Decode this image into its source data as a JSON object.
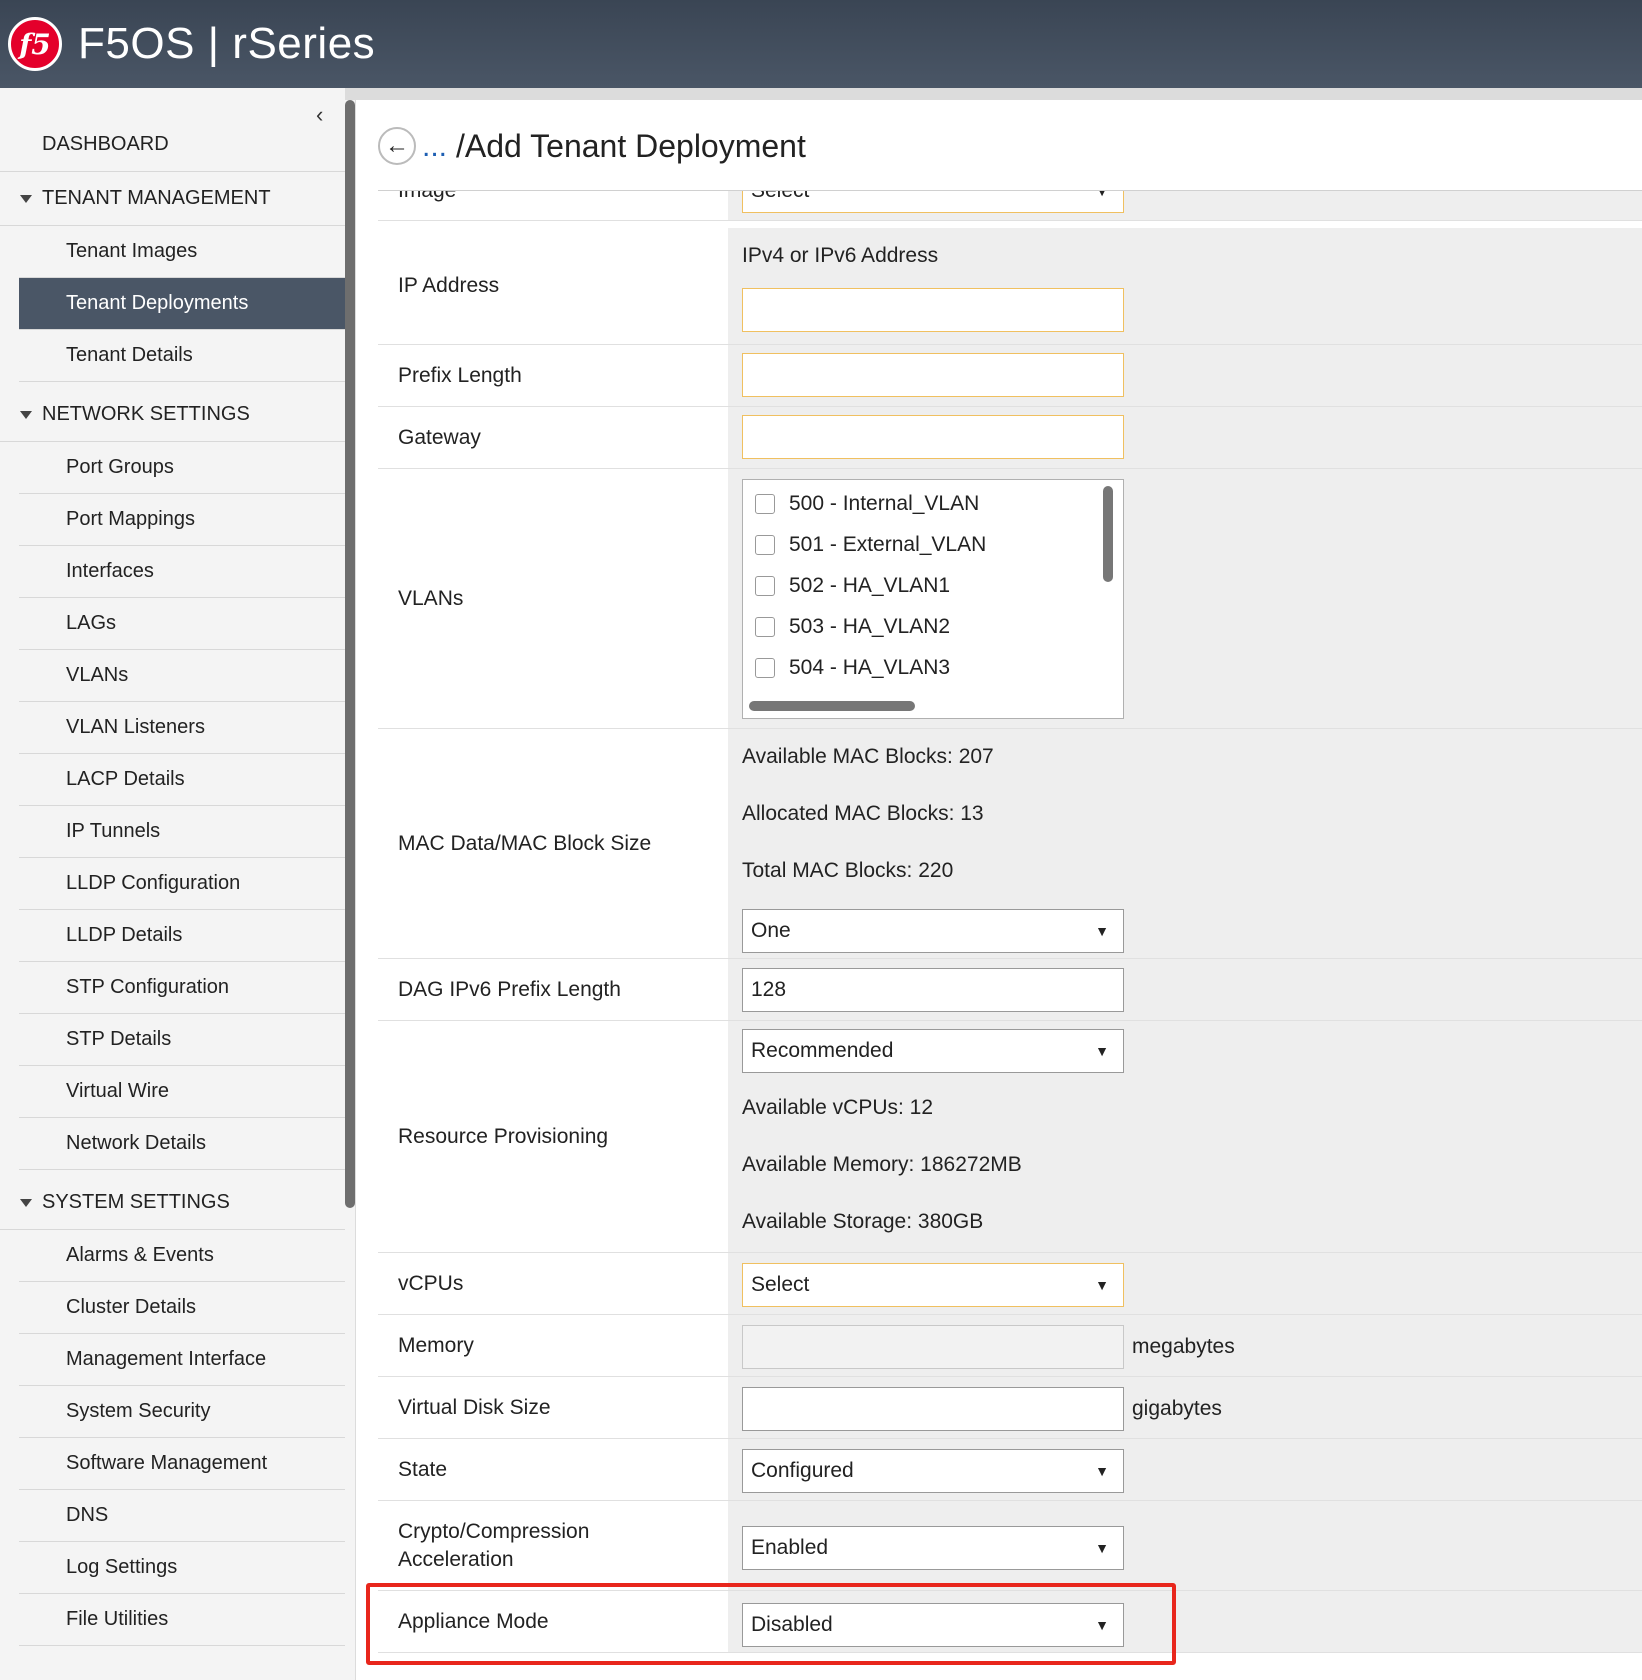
{
  "header": {
    "logo_text": "f5",
    "product": "F5OS | rSeries"
  },
  "sidebar": {
    "collapse_icon": "chevron-left-icon",
    "dashboard": "DASHBOARD",
    "tenant_management": {
      "title": "TENANT MANAGEMENT",
      "items": [
        "Tenant Images",
        "Tenant Deployments",
        "Tenant Details"
      ],
      "active": "Tenant Deployments"
    },
    "network_settings": {
      "title": "NETWORK SETTINGS",
      "items": [
        "Port Groups",
        "Port Mappings",
        "Interfaces",
        "LAGs",
        "VLANs",
        "VLAN Listeners",
        "LACP Details",
        "IP Tunnels",
        "LLDP Configuration",
        "LLDP Details",
        "STP Configuration",
        "STP Details",
        "Virtual Wire",
        "Network Details"
      ]
    },
    "system_settings": {
      "title": "SYSTEM SETTINGS",
      "items": [
        "Alarms & Events",
        "Cluster Details",
        "Management Interface",
        "System Security",
        "Software Management",
        "DNS",
        "Log Settings",
        "File Utilities"
      ]
    }
  },
  "page": {
    "breadcrumb_ellipsis": "...",
    "title": "/Add Tenant Deployment"
  },
  "form": {
    "image": {
      "label": "Image",
      "value": "Select"
    },
    "ip_address": {
      "label": "IP Address",
      "hint": "IPv4 or IPv6 Address",
      "value": ""
    },
    "prefix_length": {
      "label": "Prefix Length",
      "value": ""
    },
    "gateway": {
      "label": "Gateway",
      "value": ""
    },
    "vlans": {
      "label": "VLANs",
      "options": [
        "500 - Internal_VLAN",
        "501 - External_VLAN",
        "502 - HA_VLAN1",
        "503 - HA_VLAN2",
        "504 - HA_VLAN3"
      ]
    },
    "mac": {
      "label": "MAC Data/MAC Block Size",
      "available": "Available MAC Blocks: 207",
      "allocated": "Allocated MAC Blocks: 13",
      "total": "Total MAC Blocks: 220",
      "value": "One"
    },
    "dag_prefix": {
      "label": "DAG IPv6 Prefix Length",
      "value": "128"
    },
    "resource": {
      "label": "Resource Provisioning",
      "value": "Recommended",
      "vcpus": "Available vCPUs: 12",
      "memory": "Available Memory: 186272MB",
      "storage": "Available Storage: 380GB"
    },
    "vcpus": {
      "label": "vCPUs",
      "value": "Select"
    },
    "memory": {
      "label": "Memory",
      "value": "",
      "unit": "megabytes"
    },
    "disk": {
      "label": "Virtual Disk Size",
      "value": "",
      "unit": "gigabytes"
    },
    "state": {
      "label": "State",
      "value": "Configured"
    },
    "crypto": {
      "label_line1": "Crypto/Compression",
      "label_line2": "Acceleration",
      "value": "Enabled"
    },
    "appliance_mode": {
      "label": "Appliance Mode",
      "value": "Disabled"
    }
  },
  "colors": {
    "header_bg": "#4a5666",
    "active_nav": "#4a5666",
    "highlight": "#e8261c",
    "required_border": "#f0c060",
    "link": "#1e5fb3"
  }
}
